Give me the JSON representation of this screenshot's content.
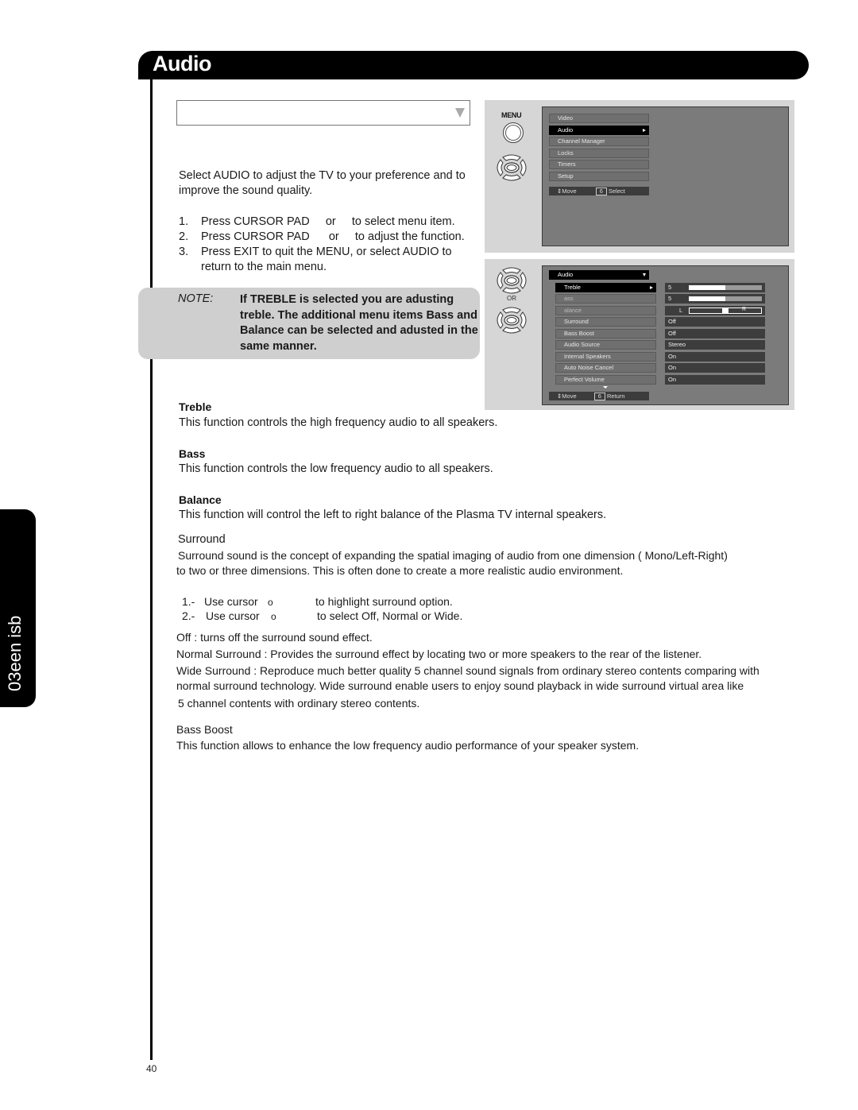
{
  "header": {
    "title": "Audio"
  },
  "side_tab": {
    "label": "03een isb"
  },
  "select_box": {
    "value": ""
  },
  "intro": {
    "text": "Select AUDIO to adjust the TV to your preference and to improve the sound quality.",
    "steps": [
      {
        "num": "1.",
        "text": "Press CURSOR PAD     or     to select menu item."
      },
      {
        "num": "2.",
        "text": "Press CURSOR PAD      or     to adjust the function."
      },
      {
        "num": "3.",
        "text": "Press EXIT to quit the MENU, or select AUDIO to return to the main menu."
      }
    ]
  },
  "note": {
    "label": "NOTE:",
    "text": "If TREBLE is selected you are adusting treble.  The additional menu items Bass and Balance can be selected and adusted in the same manner."
  },
  "main_menu_panel": {
    "menu_button_label": "MENU",
    "items": [
      {
        "label": "Video",
        "selected": false
      },
      {
        "label": "Audio",
        "selected": true
      },
      {
        "label": "Channel Manager",
        "selected": false
      },
      {
        "label": "Locks",
        "selected": false
      },
      {
        "label": "Timers",
        "selected": false
      },
      {
        "label": "Setup",
        "selected": false
      }
    ],
    "hint": {
      "move": "Move",
      "key": "6",
      "action": "Select"
    }
  },
  "audio_menu_panel": {
    "or_label": "OR",
    "title": "Audio",
    "items": [
      {
        "label": "Treble",
        "value": "5",
        "level": 0.5,
        "selected": true
      },
      {
        "label": "ass",
        "value": "5",
        "level": 0.5,
        "selected": false
      },
      {
        "label": "alance",
        "value": "L",
        "value_right": "R",
        "balance": 0.5,
        "selected": false
      },
      {
        "label": "Surround",
        "value": "Off"
      },
      {
        "label": "Bass Boost",
        "value": "Off"
      },
      {
        "label": "Audio Source",
        "value": "Stereo"
      },
      {
        "label": "Internal Speakers",
        "value": "On"
      },
      {
        "label": "Auto Noise Cancel",
        "value": "On"
      },
      {
        "label": "Perfect Volume",
        "value": "On"
      }
    ],
    "hint": {
      "move": "Move",
      "key": "6",
      "action": "Return"
    }
  },
  "sections": {
    "treble": {
      "heading": "Treble",
      "text": "This function controls the high frequency audio to all speakers."
    },
    "bass": {
      "heading": "Bass",
      "text": "This function controls the low frequency audio to all speakers."
    },
    "balance": {
      "heading": "Balance",
      "text": "This function will control the left to right balance of the Plasma TV internal speakers."
    },
    "surround": {
      "heading": "Surround",
      "text1": "Surround sound is the concept of expanding the spatial imaging of audio from one dimension ( Mono/Left-Right)",
      "text2": "to two or three dimensions. This is often done to create a more realistic audio environment.",
      "steps": [
        {
          "num": "1.-",
          "label": "Use cursor",
          "glyph": "o",
          "text": "to highlight surround option."
        },
        {
          "num": "2.-",
          "label": "Use cursor",
          "glyph": "o",
          "text": "to select Off, Normal or Wide."
        }
      ],
      "off": "Off : turns off the surround sound effect.",
      "normal": "Normal Surround :  Provides the surround effect by locating two or more speakers to the rear of the listener.",
      "wide1": "Wide Surround : Reproduce much better quality 5 channel sound signals from ordinary stereo contents comparing with",
      "wide2": "normal surround technology. Wide surround enable users to enjoy sound playback in wide surround virtual area like",
      "wide3": "5 channel contents with ordinary stereo contents."
    },
    "bass_boost": {
      "heading": "Bass Boost",
      "text": "This function allows to enhance the low frequency audio performance of your speaker system."
    }
  },
  "page_number": "40"
}
